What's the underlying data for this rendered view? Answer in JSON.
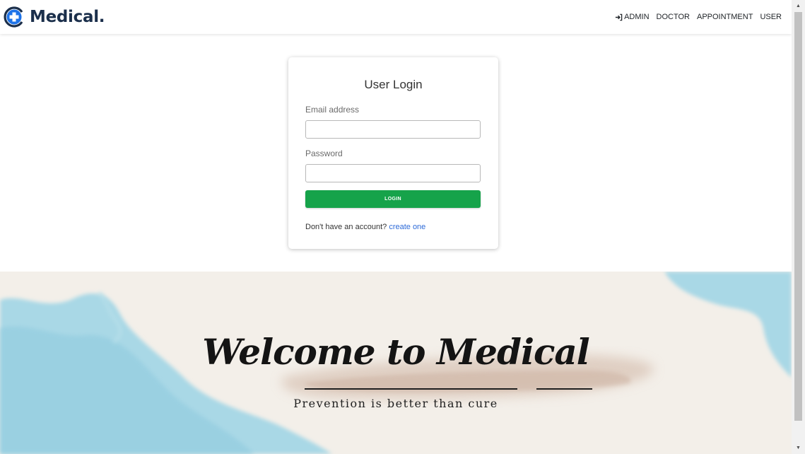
{
  "brand": {
    "name": "Medical."
  },
  "nav": {
    "items": [
      {
        "label": "ADMIN",
        "icon": "sign-in-icon"
      },
      {
        "label": "DOCTOR"
      },
      {
        "label": "APPOINTMENT"
      },
      {
        "label": "USER"
      }
    ]
  },
  "login": {
    "title": "User Login",
    "email_label": "Email address",
    "email_value": "",
    "password_label": "Password",
    "password_value": "",
    "button_label": "LOGIN",
    "signup_prompt": "Don't have an account?",
    "signup_link": "create one"
  },
  "hero": {
    "heading": "Welcome to Medical",
    "subheading": "Prevention is better than cure"
  },
  "colors": {
    "brand_navy": "#1b2f4b",
    "logo_blue": "#1e73e8",
    "button_green": "#16a34a",
    "link_blue": "#2e6bd8",
    "hero_blue": "#a9d8e6",
    "hero_beige": "#f3efe9"
  }
}
